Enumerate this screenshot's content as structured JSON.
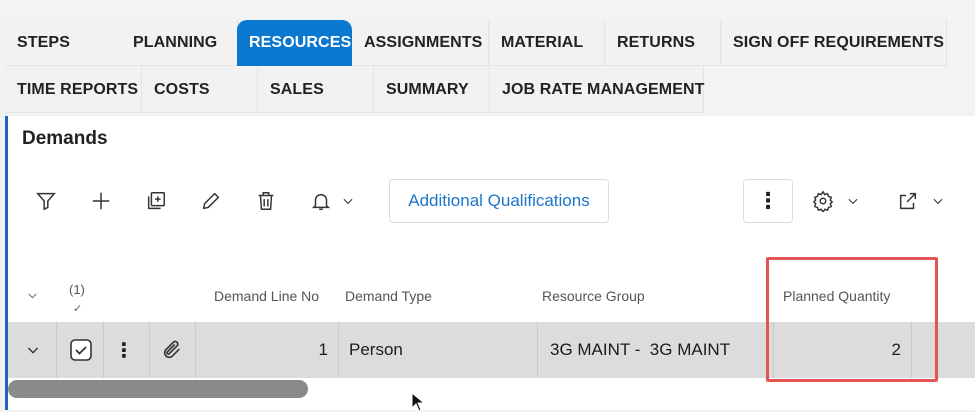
{
  "tabs": [
    {
      "label": "STEPS",
      "active": false
    },
    {
      "label": "PLANNING",
      "active": false
    },
    {
      "label": "RESOURCES",
      "active": true
    },
    {
      "label": "ASSIGNMENTS",
      "active": false
    },
    {
      "label": "MATERIAL",
      "active": false
    },
    {
      "label": "RETURNS",
      "active": false
    },
    {
      "label": "SIGN OFF REQUIREMENTS",
      "active": false
    },
    {
      "label": "TIME REPORTS",
      "active": false
    },
    {
      "label": "COSTS",
      "active": false
    },
    {
      "label": "SALES",
      "active": false
    },
    {
      "label": "SUMMARY",
      "active": false
    },
    {
      "label": "JOB RATE MANAGEMENT",
      "active": false
    }
  ],
  "section": {
    "title": "Demands"
  },
  "toolbar": {
    "icons": [
      "filter-icon",
      "add-icon",
      "duplicate-icon",
      "edit-icon",
      "delete-icon",
      "bell-icon",
      "gear-icon",
      "export-icon"
    ],
    "qualifications_label": "Additional Qualifications",
    "more_label": "⋮"
  },
  "table": {
    "selected_count": "(1)",
    "columns": {
      "demand_line_no": "Demand Line No",
      "demand_type": "Demand Type",
      "resource_group": "Resource Group",
      "planned_quantity": "Planned Quantity"
    },
    "rows": [
      {
        "demand_line_no": "1",
        "demand_type": "Person",
        "resource_group": "3G MAINT -  3G MAINT",
        "planned_quantity": "2",
        "selected": true
      }
    ]
  },
  "colors": {
    "accent": "#0b78d0",
    "highlight": "#e35656",
    "row_selected": "#dcdcdc"
  }
}
